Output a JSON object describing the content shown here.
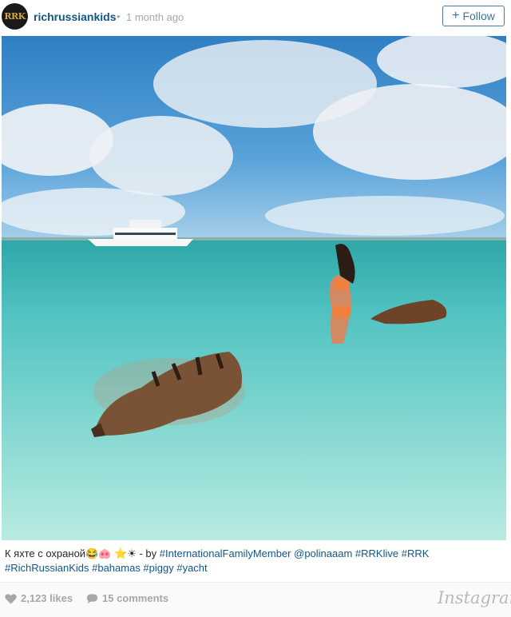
{
  "post": {
    "avatar_text": "RRK",
    "username": "richrussiankids",
    "separator": "•",
    "time_ago": "1 month ago",
    "follow_label": "Follow",
    "follow_plus": "+",
    "photo_alt": "Photo",
    "caption_text": "К яхте с охраной😂🐽 ⭐☀ - by ",
    "caption_tags": "#InternationalFamilyMember @polinaaam #RRKlive #RRK #RichRussianKids #bahamas #piggy #yacht",
    "likes": "2,123 likes",
    "comments": "15 comments",
    "brand": "Instagram"
  },
  "colors": {
    "link_blue": "#125688",
    "follow_border": "#4c7aa1",
    "muted_gray": "#a5a7aa",
    "sea": "#5bc8c7",
    "sky": "#3d8fd0"
  },
  "icons": {
    "user_tag": "user-silhouette-icon",
    "heart": "heart-icon",
    "comment": "comment-bubble-icon"
  }
}
